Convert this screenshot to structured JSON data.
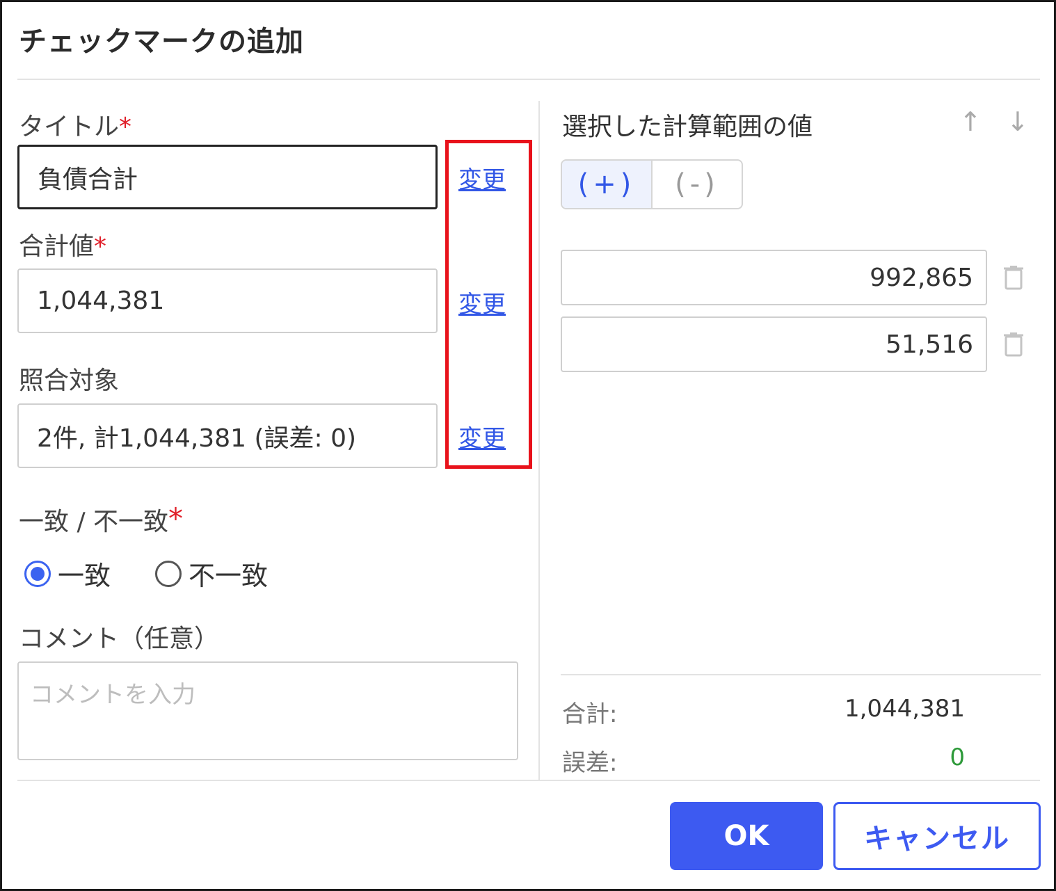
{
  "dialog": {
    "title": "チェックマークの追加",
    "ok_label": "OK",
    "cancel_label": "キャンセル"
  },
  "form": {
    "title_label": "タイトル",
    "title_value": "負債合計",
    "total_label": "合計値",
    "total_value": "1,044,381",
    "target_label": "照合対象",
    "target_value": "2件, 計1,044,381 (誤差: 0)",
    "change_link": "変更",
    "required_mark": "*",
    "match_label": "一致 / 不一致",
    "match_option": "一致",
    "mismatch_option": "不一致",
    "selected_option": "一致",
    "comment_label": "コメント（任意）",
    "comment_placeholder": "コメントを入力"
  },
  "range_panel": {
    "title": "選択した計算範囲の値",
    "up_icon": "arrow-up-icon",
    "down_icon": "arrow-down-icon",
    "plus_label": "(+)",
    "minus_label": "(-)",
    "active_sign": "(+)",
    "values": [
      "992,865",
      "51,516"
    ],
    "sum_label": "合計:",
    "sum_value": "1,044,381",
    "diff_label": "誤差:",
    "diff_value": "0"
  },
  "colors": {
    "accent": "#3d5af1",
    "link": "#3257e6",
    "required": "#e0202a",
    "highlight_box": "#e8121b",
    "diff_ok": "#2e9a3a"
  }
}
